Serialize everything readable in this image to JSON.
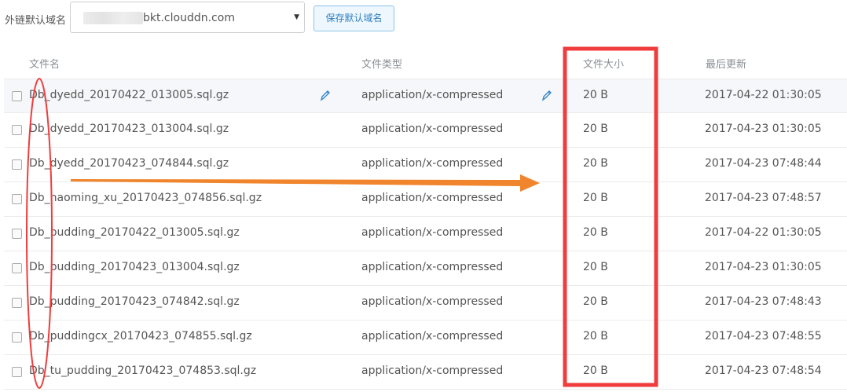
{
  "topbar": {
    "domain_label": "外链默认域名",
    "domain_value": "bkt.clouddn.com",
    "save_button": "保存默认域名"
  },
  "table": {
    "headers": [
      "文件名",
      "文件类型",
      "文件大小",
      "最后更新"
    ],
    "rows": [
      {
        "name": "Db_dyedd_20170422_013005.sql.gz",
        "type": "application/x-compressed",
        "size": "20 B",
        "updated": "2017-04-22 01:30:05"
      },
      {
        "name": "Db_dyedd_20170423_013004.sql.gz",
        "type": "application/x-compressed",
        "size": "20 B",
        "updated": "2017-04-23 01:30:05"
      },
      {
        "name": "Db_dyedd_20170423_074844.sql.gz",
        "type": "application/x-compressed",
        "size": "20 B",
        "updated": "2017-04-23 07:48:44"
      },
      {
        "name": "Db_haoming_xu_20170423_074856.sql.gz",
        "type": "application/x-compressed",
        "size": "20 B",
        "updated": "2017-04-23 07:48:57"
      },
      {
        "name": "Db_pudding_20170422_013005.sql.gz",
        "type": "application/x-compressed",
        "size": "20 B",
        "updated": "2017-04-22 01:30:05"
      },
      {
        "name": "Db_pudding_20170423_013004.sql.gz",
        "type": "application/x-compressed",
        "size": "20 B",
        "updated": "2017-04-23 01:30:05"
      },
      {
        "name": "Db_pudding_20170423_074842.sql.gz",
        "type": "application/x-compressed",
        "size": "20 B",
        "updated": "2017-04-23 07:48:43"
      },
      {
        "name": "Db_puddingcx_20170423_074855.sql.gz",
        "type": "application/x-compressed",
        "size": "20 B",
        "updated": "2017-04-23 07:48:55"
      },
      {
        "name": "Db_tu_pudding_20170423_074853.sql.gz",
        "type": "application/x-compressed",
        "size": "20 B",
        "updated": "2017-04-23 07:48:54"
      }
    ]
  },
  "icons": {
    "edit": "pencil-icon",
    "dropdown": "caret-down-icon"
  },
  "colors": {
    "annotation_red": "#f03c3c",
    "annotation_orange": "#f0852d",
    "accent_blue": "#2e7fc0"
  }
}
